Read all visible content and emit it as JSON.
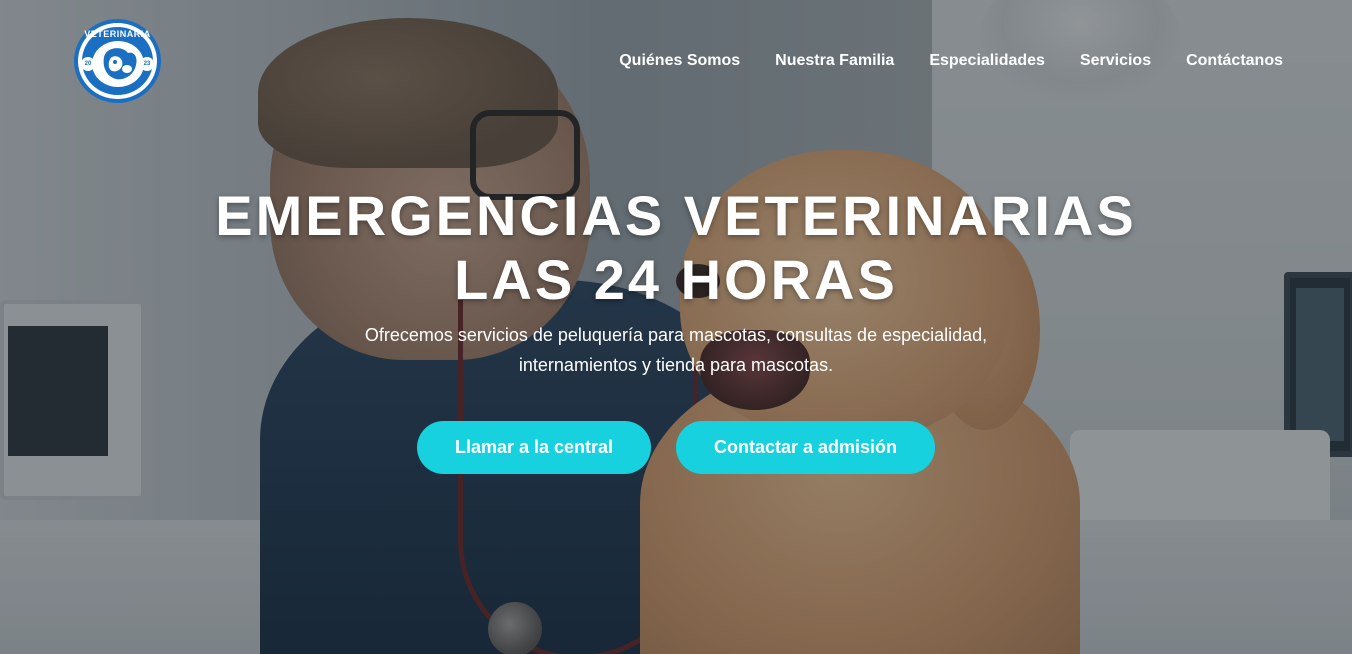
{
  "logo": {
    "text": "VETERINARIA",
    "year_left": "20",
    "year_right": "23"
  },
  "nav": {
    "items": [
      "Quiénes Somos",
      "Nuestra Familia",
      "Especialidades",
      "Servicios",
      "Contáctanos"
    ]
  },
  "hero": {
    "title_line1": "EMERGENCIAS VETERINARIAS",
    "title_line2": "LAS 24 HORAS",
    "subtitle": "Ofrecemos servicios de peluquería para mascotas, consultas de especialidad, internamientos y tienda para mascotas.",
    "buttons": {
      "call": "Llamar a la central",
      "admission": "Contactar a admisión"
    }
  },
  "colors": {
    "accent": "#17d1de",
    "logo_blue": "#1a6fc2",
    "text": "#ffffff"
  }
}
